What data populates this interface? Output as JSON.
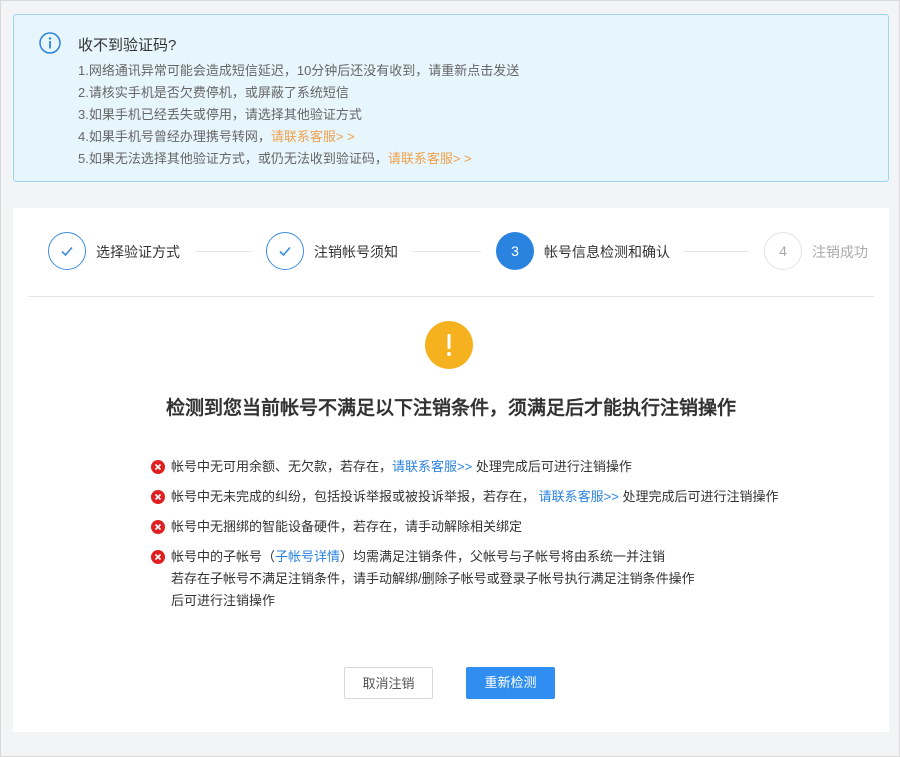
{
  "notice": {
    "title": "收不到验证码?",
    "lines": [
      {
        "text": "1.网络通讯异常可能会造成短信延迟，10分钟后还没有收到，请重新点击发送"
      },
      {
        "text": "2.请核实手机是否欠费停机，或屏蔽了系统短信"
      },
      {
        "text": "3.如果手机已经丢失或停用，请选择其他验证方式"
      },
      {
        "text": "4.如果手机号曾经办理携号转网，",
        "link": "请联系客服> >"
      },
      {
        "text": "5.如果无法选择其他验证方式，或仍无法收到验证码，",
        "link": "请联系客服> >"
      }
    ]
  },
  "steps": [
    {
      "number": "1",
      "label": "选择验证方式",
      "state": "done"
    },
    {
      "number": "2",
      "label": "注销帐号须知",
      "state": "done"
    },
    {
      "number": "3",
      "label": "帐号信息检测和确认",
      "state": "active"
    },
    {
      "number": "4",
      "label": "注销成功",
      "state": "pending"
    }
  ],
  "headline": "检测到您当前帐号不满足以下注销条件，须满足后才能执行注销操作",
  "conditions": {
    "c1": {
      "pre": "帐号中无可用余额、无欠款，若存在，",
      "link": "请联系客服>>",
      "post": " 处理完成后可进行注销操作"
    },
    "c2": {
      "pre": "帐号中无未完成的纠纷，包括投诉举报或被投诉举报，若存在，",
      "link": "请联系客服>>",
      "post": " 处理完成后可进行注销操作"
    },
    "c3": {
      "pre": "帐号中无捆绑的智能设备硬件，若存在，请手动解除相关绑定"
    },
    "c4": {
      "pre": "帐号中的子帐号（",
      "link": "子帐号详情",
      "post": "）均需满足注销条件，父帐号与子帐号将由系统一并注销",
      "line2": "若存在子帐号不满足注销条件，请手动解绑/删除子帐号或登录子帐号执行满足注销条件操作",
      "line3": "后可进行注销操作"
    }
  },
  "buttons": {
    "cancel": "取消注销",
    "recheck": "重新检测"
  },
  "colors": {
    "accent": "#2b83e0",
    "warning": "#f6b11f",
    "error": "#e02020",
    "link_orange": "#f0a14b"
  }
}
